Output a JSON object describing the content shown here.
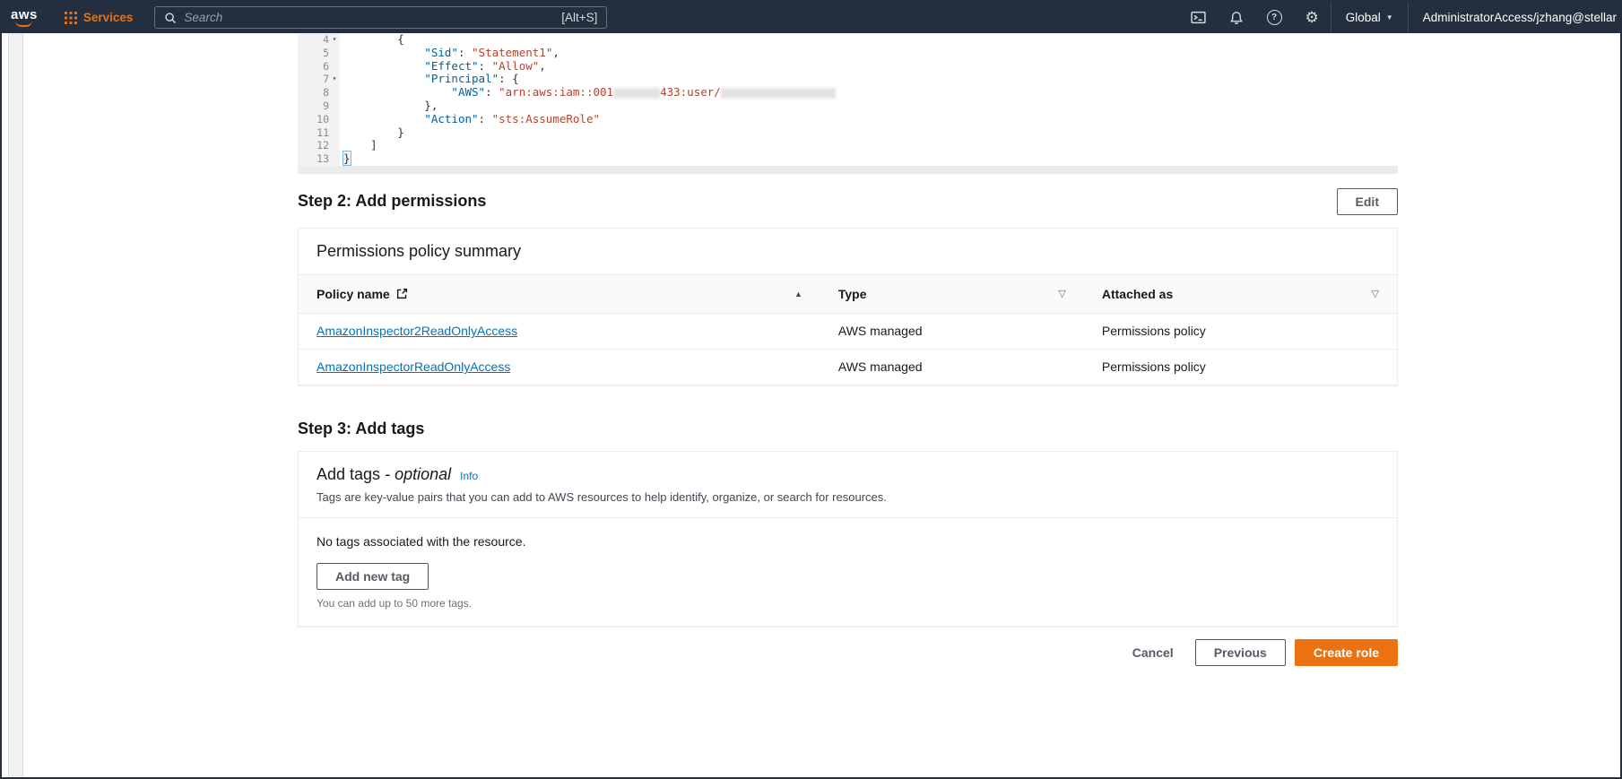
{
  "colors": {
    "accent": "#ec7211",
    "link": "#0073bb",
    "nav_bg": "#232f3e",
    "key_token": "#00619a",
    "value_token": "#b3422e"
  },
  "icons": {
    "sort_asc": "▲",
    "filter": "▽",
    "fold": "▾",
    "caret_down": "▼",
    "gear": "⚙",
    "question": "?"
  },
  "topnav": {
    "logo": "aws",
    "services": "Services",
    "search": {
      "placeholder": "Search",
      "shortcut": "[Alt+S]"
    },
    "region": "Global",
    "account": "AdministratorAccess/jzhang@stellar"
  },
  "editor": {
    "lines": [
      {
        "num": "4",
        "fold": true,
        "segs": [
          {
            "t": "        {",
            "c": "p"
          }
        ]
      },
      {
        "num": "5",
        "segs": [
          {
            "t": "            ",
            "c": "p"
          },
          {
            "t": "\"Sid\"",
            "c": "k"
          },
          {
            "t": ": ",
            "c": "p"
          },
          {
            "t": "\"Statement1\"",
            "c": "v"
          },
          {
            "t": ",",
            "c": "p"
          }
        ]
      },
      {
        "num": "6",
        "segs": [
          {
            "t": "            ",
            "c": "p"
          },
          {
            "t": "\"Effect\"",
            "c": "k"
          },
          {
            "t": ": ",
            "c": "p"
          },
          {
            "t": "\"Allow\"",
            "c": "v"
          },
          {
            "t": ",",
            "c": "p"
          }
        ]
      },
      {
        "num": "7",
        "fold": true,
        "segs": [
          {
            "t": "            ",
            "c": "p"
          },
          {
            "t": "\"Principal\"",
            "c": "k"
          },
          {
            "t": ": {",
            "c": "p"
          }
        ]
      },
      {
        "num": "8",
        "segs": [
          {
            "t": "                ",
            "c": "p"
          },
          {
            "t": "\"AWS\"",
            "c": "k"
          },
          {
            "t": ": ",
            "c": "p"
          },
          {
            "t": "\"arn:aws:iam::001",
            "c": "v"
          },
          {
            "r": 52
          },
          {
            "t": "433:user/",
            "c": "v"
          },
          {
            "r": 128
          }
        ]
      },
      {
        "num": "9",
        "segs": [
          {
            "t": "            },",
            "c": "p"
          }
        ]
      },
      {
        "num": "10",
        "segs": [
          {
            "t": "            ",
            "c": "p"
          },
          {
            "t": "\"Action\"",
            "c": "k"
          },
          {
            "t": ": ",
            "c": "p"
          },
          {
            "t": "\"sts:AssumeRole\"",
            "c": "v"
          }
        ]
      },
      {
        "num": "11",
        "segs": [
          {
            "t": "        }",
            "c": "p"
          }
        ]
      },
      {
        "num": "12",
        "segs": [
          {
            "t": "    ]",
            "c": "p"
          }
        ]
      },
      {
        "num": "13",
        "segs": [
          {
            "t": "}",
            "c": "p",
            "hl": true
          }
        ]
      }
    ]
  },
  "step2": {
    "title": "Step 2: Add permissions",
    "edit_button": "Edit",
    "card_title": "Permissions policy summary",
    "table": {
      "columns": [
        "Policy name",
        "Type",
        "Attached as"
      ],
      "rows": [
        {
          "policy": "AmazonInspector2ReadOnlyAccess",
          "type": "AWS managed",
          "attached_as": "Permissions policy"
        },
        {
          "policy": "AmazonInspectorReadOnlyAccess",
          "type": "AWS managed",
          "attached_as": "Permissions policy"
        }
      ]
    }
  },
  "step3": {
    "title": "Step 3: Add tags",
    "card_title": "Add tags",
    "card_title_optional": "- optional",
    "info_link": "Info",
    "description": "Tags are key-value pairs that you can add to AWS resources to help identify, organize, or search for resources.",
    "empty_text": "No tags associated with the resource.",
    "add_button": "Add new tag",
    "hint": "You can add up to 50 more tags."
  },
  "footer": {
    "cancel": "Cancel",
    "previous": "Previous",
    "create": "Create role"
  }
}
